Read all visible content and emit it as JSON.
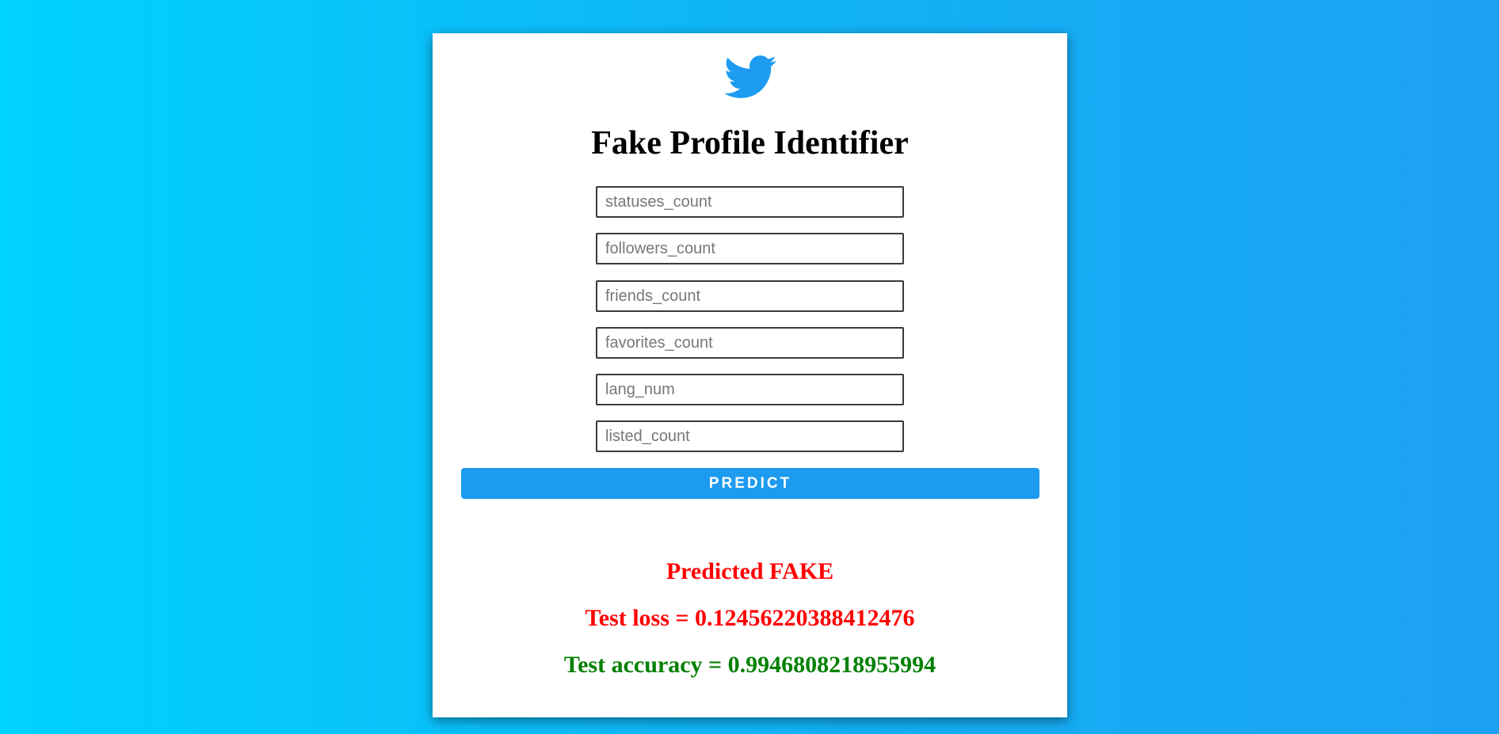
{
  "app": {
    "title": "Fake Profile Identifier",
    "logo_icon": "twitter-bird-icon",
    "accent_color": "#1d9bf0"
  },
  "form": {
    "fields": [
      {
        "name": "statuses_count",
        "placeholder": "statuses_count",
        "value": ""
      },
      {
        "name": "followers_count",
        "placeholder": "followers_count",
        "value": ""
      },
      {
        "name": "friends_count",
        "placeholder": "friends_count",
        "value": ""
      },
      {
        "name": "favorites_count",
        "placeholder": "favorites_count",
        "value": ""
      },
      {
        "name": "lang_num",
        "placeholder": "lang_num",
        "value": ""
      },
      {
        "name": "listed_count",
        "placeholder": "listed_count",
        "value": ""
      }
    ],
    "submit_label": "PREDICT"
  },
  "results": {
    "prediction": "Predicted FAKE",
    "prediction_color": "#ff0000",
    "test_loss": "Test loss = 0.12456220388412476",
    "test_loss_color": "#ff0000",
    "test_accuracy": "Test accuracy = 0.9946808218955994",
    "test_accuracy_color": "#008000"
  }
}
